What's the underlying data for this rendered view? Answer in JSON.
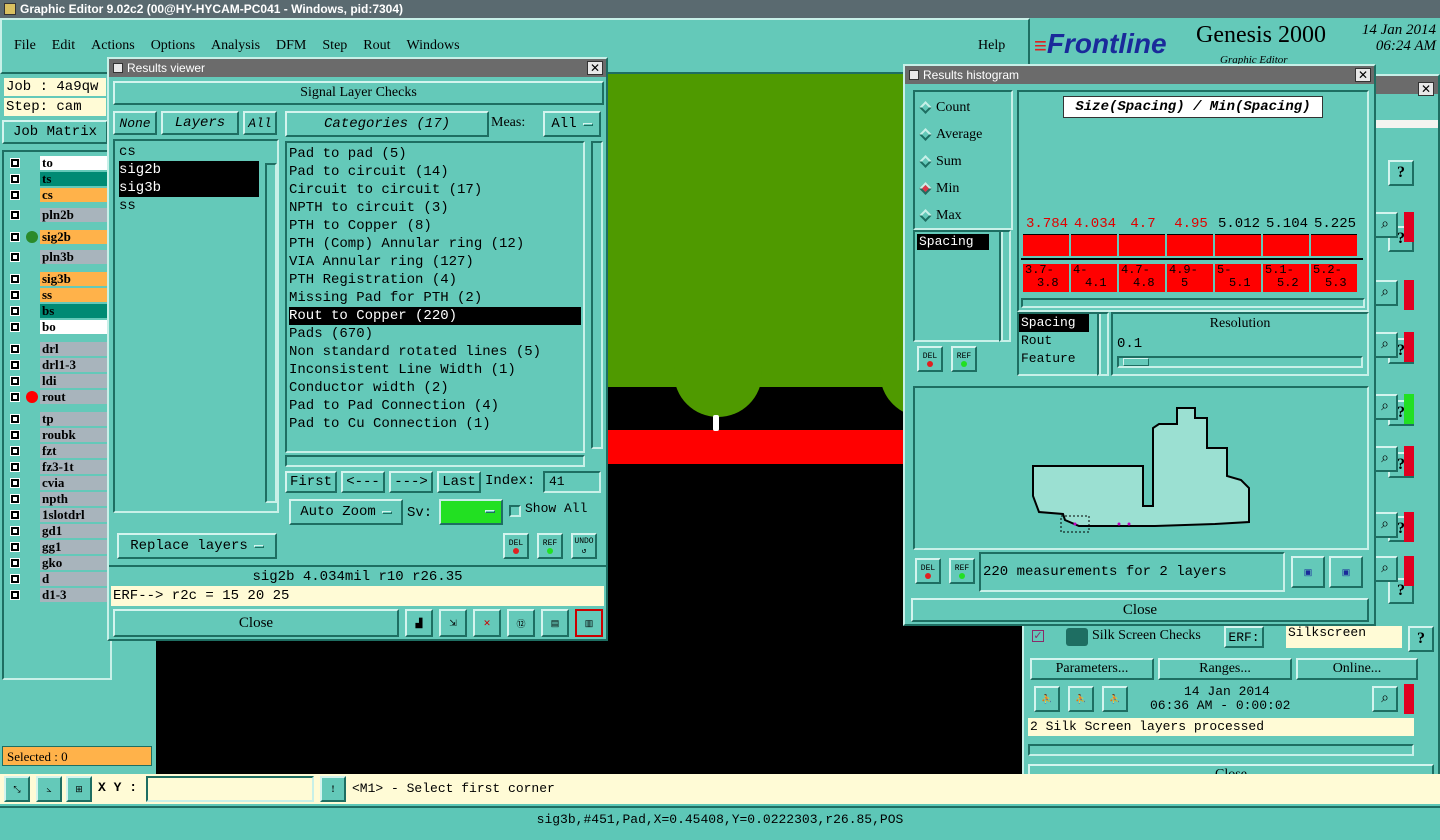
{
  "app": {
    "title": "Graphic Editor 9.02c2 (00@HY-HYCAM-PC041 - Windows, pid:7304)"
  },
  "menu": [
    "File",
    "Edit",
    "Actions",
    "Options",
    "Analysis",
    "DFM",
    "Step",
    "Rout",
    "Windows"
  ],
  "help": "Help",
  "brand": {
    "logo": "Frontline",
    "product": "Genesis 2000",
    "subtitle": "Graphic Editor",
    "date": "14 Jan 2014",
    "time": "06:24 AM"
  },
  "job": {
    "job_label": "Job : 4a9qw",
    "step_label": "Step: cam",
    "matrix_button": "Job Matrix"
  },
  "layers": [
    {
      "name": "to",
      "color": "#ffffff"
    },
    {
      "name": "ts",
      "color": "#008a74"
    },
    {
      "name": "cs",
      "color": "#ffb24a"
    },
    {
      "name": "pln2b",
      "color": "#a8b4bc"
    },
    {
      "name": "sig2b",
      "color": "#ffb24a"
    },
    {
      "name": "pln3b",
      "color": "#a8b4bc"
    },
    {
      "name": "sig3b",
      "color": "#ffb24a"
    },
    {
      "name": "ss",
      "color": "#ffb24a"
    },
    {
      "name": "bs",
      "color": "#008a74"
    },
    {
      "name": "bo",
      "color": "#ffffff"
    },
    {
      "name": "drl",
      "color": "#a8b4bc"
    },
    {
      "name": "drl1-3",
      "color": "#a8b4bc"
    },
    {
      "name": "ldi",
      "color": "#a8b4bc"
    },
    {
      "name": "rout",
      "color": "#a8b4bc"
    },
    {
      "name": "tp",
      "color": "#a8b4bc"
    },
    {
      "name": "roubk",
      "color": "#a8b4bc"
    },
    {
      "name": "fzt",
      "color": "#a8b4bc"
    },
    {
      "name": "fz3-1t",
      "color": "#a8b4bc"
    },
    {
      "name": "cvia",
      "color": "#a8b4bc"
    },
    {
      "name": "npth",
      "color": "#a8b4bc"
    },
    {
      "name": "1slotdrl",
      "color": "#a8b4bc"
    },
    {
      "name": "gd1",
      "color": "#a8b4bc"
    },
    {
      "name": "gg1",
      "color": "#a8b4bc"
    },
    {
      "name": "gko",
      "color": "#a8b4bc"
    },
    {
      "name": "d",
      "color": "#a8b4bc"
    },
    {
      "name": "d1-3",
      "color": "#a8b4bc"
    }
  ],
  "selected": "Selected : 0",
  "bottom": {
    "xy_label": "X Y :",
    "xy_value": "",
    "prompt": "<M1> - Select first corner",
    "status": "sig3b,#451,Pad,X=0.45408,Y=0.0222303,r26.85,POS"
  },
  "results_viewer": {
    "title": "Results viewer",
    "header": "Signal Layer Checks",
    "none_btn": "None",
    "layers_label": "Layers",
    "all_btn": "All",
    "categories_label": "Categories (17)",
    "meas_label": "Meas:",
    "meas_value": "All",
    "layer_list": [
      "cs",
      "sig2b",
      "sig3b",
      "ss"
    ],
    "categories": [
      "Pad to pad (5)",
      "Pad to circuit (14)",
      "Circuit to circuit (17)",
      "NPTH to circuit (3)",
      "PTH to Copper (8)",
      "PTH (Comp) Annular ring (12)",
      "VIA Annular ring (127)",
      "PTH Registration (4)",
      "Missing Pad for PTH (2)",
      "Rout to Copper (220)",
      "Pads (670)",
      "Non standard rotated lines (5)",
      "Inconsistent Line Width (1)",
      "Conductor width (2)",
      "Pad to Pad Connection (4)",
      "Pad to Cu Connection (1)"
    ],
    "first": "First",
    "prev": "<---",
    "next": "--->",
    "last": "Last",
    "index_label": "Index:",
    "index_value": "41",
    "auto_zoom": "Auto Zoom",
    "sv_label": "Sv:",
    "show_all": "Show All",
    "replace_layers": "Replace layers",
    "del": "DEL",
    "ref": "REF",
    "undo": "UNDO",
    "info": "sig2b 4.034mil   r10   r26.35",
    "erf": "ERF--> r2c = 15 20 25",
    "close": "Close"
  },
  "histogram": {
    "title": "Results histogram",
    "options": [
      "Count",
      "Average",
      "Sum",
      "Min",
      "Max"
    ],
    "selected_option": "Min",
    "chart_title": "Size(Spacing) / Min(Spacing)",
    "spacing_item": "Spacing",
    "bar_values": [
      "3.784",
      "4.034",
      "4.7",
      "4.95",
      "5.012",
      "5.104",
      "5.225"
    ],
    "bar_highlight": [
      true,
      true,
      true,
      true,
      false,
      false,
      false
    ],
    "ranges": [
      [
        "3.7-",
        "3.8"
      ],
      [
        "4-",
        "4.1"
      ],
      [
        "4.7-",
        "4.8"
      ],
      [
        "4.9-",
        "5"
      ],
      [
        "5-",
        "5.1"
      ],
      [
        "5.1-",
        "5.2"
      ],
      [
        "5.2-",
        "5.3"
      ]
    ],
    "measure_list": [
      "Spacing",
      "Rout",
      "Feature"
    ],
    "resolution_label": "Resolution",
    "resolution_value": "0.1",
    "summary": "220 measurements for 2 layers",
    "close": "Close"
  },
  "checklist": {
    "silk_name": "Silk Screen Checks",
    "erf_label": "ERF:",
    "erf_value": "Silkscreen",
    "parameters": "Parameters...",
    "ranges": "Ranges...",
    "online": "Online...",
    "run_date": "14 Jan 2014",
    "run_time": "06:36 AM - 0:00:02",
    "message": "2 Silk Screen layers processed",
    "close": "Close"
  },
  "colors": {
    "panel": "#64c9b9",
    "canvas": "#000000",
    "copper": "#4f9a00",
    "red": "#ff0000",
    "highlight": "#ffb24a"
  }
}
